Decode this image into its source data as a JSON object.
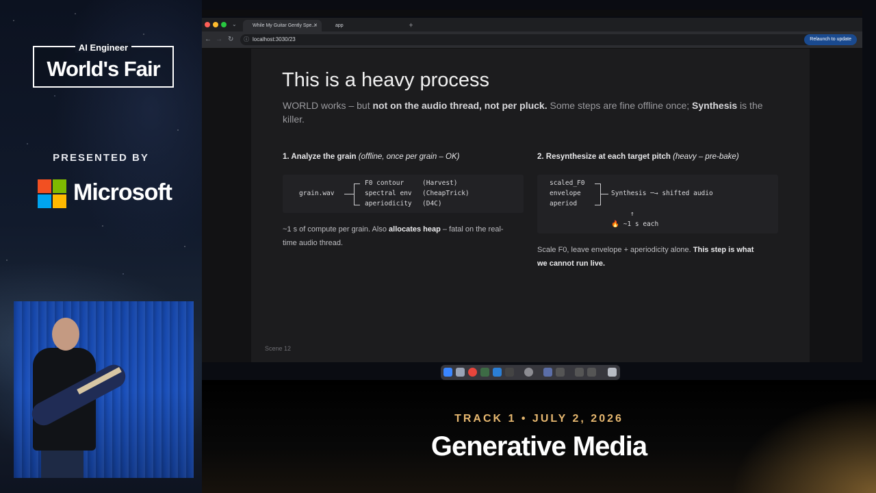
{
  "event": {
    "logo_small": "AI Engineer",
    "logo_big": "World's Fair",
    "presented_by": "PRESENTED BY",
    "sponsor": "Microsoft",
    "track_line": "TRACK 1 • JULY 2, 2026",
    "track_title": "Generative Media"
  },
  "browser": {
    "tabs": [
      {
        "label": "While My Guitar Gently Spe..."
      },
      {
        "label": "app"
      }
    ],
    "url": "localhost:3030/23",
    "relaunch_label": "Relaunch to update"
  },
  "slide": {
    "title": "This is a heavy process",
    "subtitle": {
      "p1": "WORLD works – but ",
      "b1": "not on the audio thread, not per pluck.",
      "p2": " Some steps are fine offline once; ",
      "b2": "Synthesis",
      "p3": " is the killer."
    },
    "col1": {
      "heading": "1. Analyze the grain ",
      "heading_note": "(offline, once per grain – OK)",
      "code_input": "grain.wav",
      "code_rows": [
        {
          "name": "F0 contour",
          "method": "(Harvest)"
        },
        {
          "name": "spectral env",
          "method": "(CheapTrick)"
        },
        {
          "name": "aperiodicity",
          "method": "(D4C)"
        }
      ],
      "body_p1": "~1 s of compute per grain. Also ",
      "body_b": "allocates heap",
      "body_p2": " – fatal on the real-",
      "body_line2": "time audio thread."
    },
    "col2": {
      "heading": "2. Resynthesize at each target pitch ",
      "heading_note": "(heavy – pre-bake)",
      "code_inputs": [
        "scaled_F0",
        "envelope",
        "aperiod"
      ],
      "code_output": "Synthesis ─→ shifted audio",
      "up_arrow": "↑",
      "cost_icon": "🔥",
      "cost": " ~1 s each",
      "body_p1": "Scale F0, leave envelope + aperiodicity alone. ",
      "body_b1": "This step is what",
      "body_b2": "we cannot run live."
    },
    "scene_label": "Scene 12"
  },
  "colors": {
    "track_accent": "#e7b870",
    "relaunch_bg": "#1a4a8f",
    "slide_bg": "#1c1c1e"
  }
}
